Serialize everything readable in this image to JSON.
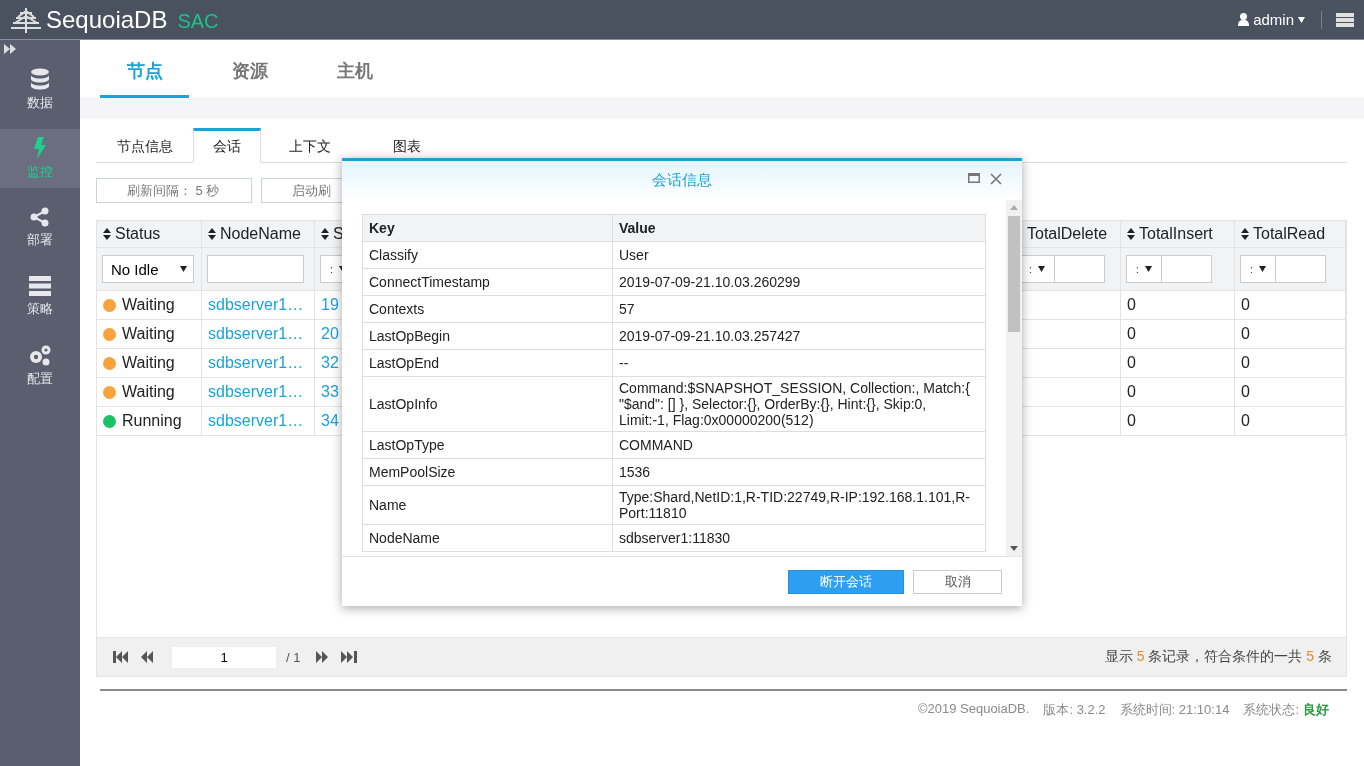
{
  "header": {
    "logo": "SequoiaDB",
    "product": "SAC",
    "user": "admin"
  },
  "sidebar": [
    {
      "label": "数据",
      "selected": false
    },
    {
      "label": "监控",
      "selected": true
    },
    {
      "label": "部署",
      "selected": false
    },
    {
      "label": "策略",
      "selected": false
    },
    {
      "label": "配置",
      "selected": false
    }
  ],
  "main_tabs": [
    {
      "label": "节点",
      "selected": true
    },
    {
      "label": "资源",
      "selected": false
    },
    {
      "label": "主机",
      "selected": false
    }
  ],
  "sub_tabs": [
    {
      "label": "节点信息",
      "selected": false
    },
    {
      "label": "会话",
      "selected": true
    },
    {
      "label": "上下文",
      "selected": false
    },
    {
      "label": "图表",
      "selected": false
    }
  ],
  "toolbar": [
    "刷新间隔： 5 秒",
    "启动刷"
  ],
  "table": {
    "columns": [
      {
        "title": "Status",
        "filter": {
          "kind": "select",
          "value": "No Idle"
        }
      },
      {
        "title": "NodeName",
        "filter": {
          "kind": "text"
        }
      },
      {
        "title": "S",
        "filter": {
          "kind": "op",
          "operator": ":"
        }
      },
      {
        "title": "TotalDelete",
        "filter": {
          "kind": "op",
          "operator": ":"
        }
      },
      {
        "title": "TotalInsert",
        "filter": {
          "kind": "op",
          "operator": ":"
        }
      },
      {
        "title": "TotalRead",
        "filter": {
          "kind": "op",
          "operator": ":"
        }
      }
    ],
    "rows": [
      {
        "status": "Waiting",
        "color": "#f7a23b",
        "node_name": "sdbserver1…",
        "column_3": "19",
        "total_insert": "0",
        "total_read": "0"
      },
      {
        "status": "Waiting",
        "color": "#f7a23b",
        "node_name": "sdbserver1…",
        "column_3": "20",
        "total_insert": "0",
        "total_read": "0"
      },
      {
        "status": "Waiting",
        "color": "#f7a23b",
        "node_name": "sdbserver1…",
        "column_3": "32",
        "total_insert": "0",
        "total_read": "0"
      },
      {
        "status": "Waiting",
        "color": "#f7a23b",
        "node_name": "sdbserver1…",
        "column_3": "33",
        "total_insert": "0",
        "total_read": "0"
      },
      {
        "status": "Running",
        "color": "#19c364",
        "node_name": "sdbserver1…",
        "column_3": "34",
        "total_insert": "0",
        "total_read": "0"
      }
    ]
  },
  "pager": {
    "page": "1",
    "total": "/ 1",
    "summary": [
      {
        "kind": "text",
        "text": "显示"
      },
      {
        "kind": "count",
        "text": "5"
      },
      {
        "kind": "text",
        "text": "条记录，符合条件的一共"
      },
      {
        "kind": "count",
        "text": "5"
      },
      {
        "kind": "text",
        "text": "条"
      }
    ]
  },
  "footer": {
    "copyright": "©2019 SequoiaDB.",
    "version": "版本: 3.2.2",
    "time": "系统时间: 21:10:14",
    "status_label": "系统状态:",
    "status_value": "良好"
  },
  "dialog": {
    "title": "会话信息",
    "columns": [
      "Key",
      "Value"
    ],
    "rows": [
      {
        "key": "Classify",
        "value": "User"
      },
      {
        "key": "ConnectTimestamp",
        "value": "2019-07-09-21.10.03.260299"
      },
      {
        "key": "Contexts",
        "value": "57"
      },
      {
        "key": "LastOpBegin",
        "value": "2019-07-09-21.10.03.257427"
      },
      {
        "key": "LastOpEnd",
        "value": "--"
      },
      {
        "key": "LastOpInfo",
        "value": "Command:$SNAPSHOT_SESSION, Collection:, Match:{ \"$and\": [] }, Selector:{}, OrderBy:{}, Hint:{}, Skip:0, Limit:-1, Flag:0x00000200(512)"
      },
      {
        "key": "LastOpType",
        "value": "COMMAND"
      },
      {
        "key": "MemPoolSize",
        "value": "1536"
      },
      {
        "key": "Name",
        "value": "Type:Shard,NetID:1,R-TID:22749,R-IP:192.168.1.101,R-Port:11810"
      },
      {
        "key": "NodeName",
        "value": "sdbserver1:11830"
      }
    ],
    "buttons": [
      {
        "label": "断开会话",
        "kind": "primary"
      },
      {
        "label": "取消",
        "kind": "default"
      }
    ]
  }
}
